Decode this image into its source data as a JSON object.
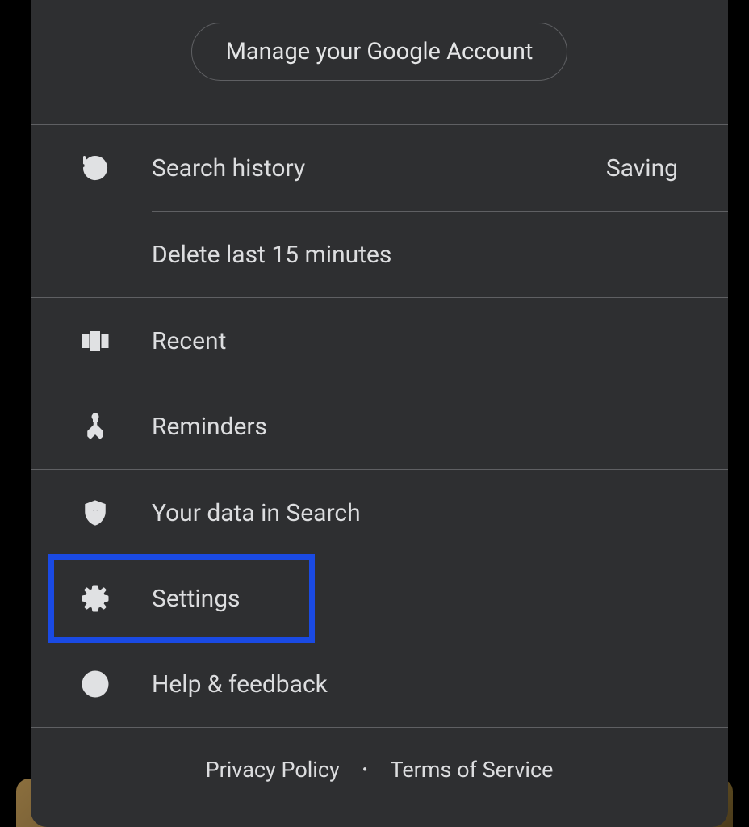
{
  "header": {
    "manage_button": "Manage your Google Account"
  },
  "menu": {
    "search_history": {
      "label": "Search history",
      "status": "Saving"
    },
    "delete_15": "Delete last 15 minutes",
    "recent": "Recent",
    "reminders": "Reminders",
    "your_data": "Your data in Search",
    "settings": "Settings",
    "help": "Help & feedback"
  },
  "footer": {
    "privacy": "Privacy Policy",
    "separator": "•",
    "terms": "Terms of Service"
  }
}
